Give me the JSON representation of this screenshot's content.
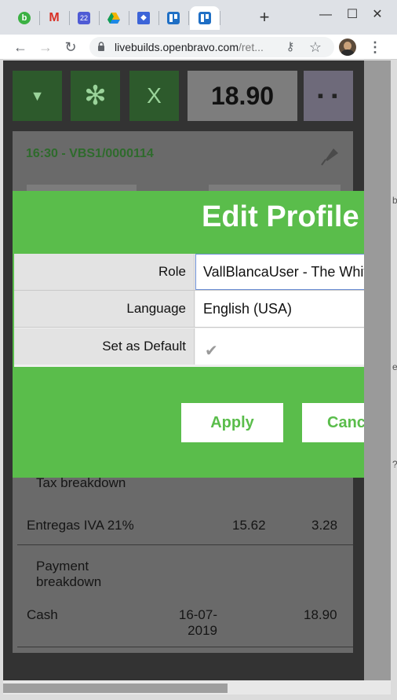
{
  "browser": {
    "tabs": [
      {
        "name": "bravo-tab",
        "color": "#3bb143",
        "glyph": "b"
      },
      {
        "name": "gmail-tab",
        "color": "#d93025",
        "glyph": "M"
      },
      {
        "name": "calendar-tab",
        "color": "#4f5bd5",
        "glyph": "22"
      },
      {
        "name": "drive-tab",
        "color": "#f4b400",
        "glyph": "▲"
      },
      {
        "name": "bitwarden-tab",
        "color": "#3c64d8",
        "glyph": "♦"
      },
      {
        "name": "trello-tab-1",
        "color": "#1f6fc5",
        "glyph": "▥"
      },
      {
        "name": "trello-tab-2",
        "color": "#1f6fc5",
        "glyph": "▥"
      }
    ],
    "newtab": "+",
    "url_host": "livebuilds.openbravo.com",
    "url_rest": "/ret..."
  },
  "pos": {
    "total": "18.90",
    "receipt_title": "16:30 - VBS1/0000114",
    "tax_breakdown_label": "Tax breakdown",
    "tax_row": {
      "name": "Entregas IVA 21%",
      "base": "15.62",
      "amount": "3.28"
    },
    "payment_breakdown_label": "Payment breakdown",
    "payment_row": {
      "method": "Cash",
      "date": "16-07-2019",
      "amount": "18.90"
    }
  },
  "dialog": {
    "title": "Edit Profile",
    "fields": [
      {
        "label": "Role",
        "value": "VallBlancaUser - The White Valley Group"
      },
      {
        "label": "Language",
        "value": "English (USA)"
      },
      {
        "label": "Set as Default",
        "value": ""
      }
    ],
    "apply_label": "Apply",
    "cancel_label": "Cancel"
  },
  "colors": {
    "accent_green": "#5abd4b",
    "dark_green": "#2d5a2c",
    "focus_border": "#6c8fd6"
  }
}
